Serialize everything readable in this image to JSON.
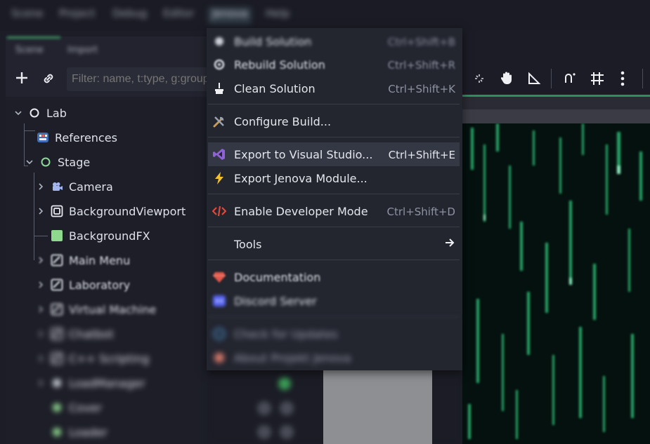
{
  "menubar": {
    "items": [
      {
        "label": "Scene"
      },
      {
        "label": "Project"
      },
      {
        "label": "Debug"
      },
      {
        "label": "Editor"
      },
      {
        "label": "Jenova"
      },
      {
        "label": "Help"
      }
    ]
  },
  "scene_dock": {
    "tabs": [
      "Scene",
      "Import"
    ],
    "filter_placeholder": "Filter: name, t:type, g:group",
    "tree": [
      {
        "label": "Lab",
        "icon": "node-circle-icon"
      },
      {
        "label": "References",
        "icon": "references-icon"
      },
      {
        "label": "Stage",
        "icon": "node-circle-green-icon"
      },
      {
        "label": "Camera",
        "icon": "camera-icon"
      },
      {
        "label": "BackgroundViewport",
        "icon": "viewport-icon"
      },
      {
        "label": "BackgroundFX",
        "icon": "color-rect-icon"
      },
      {
        "label": "Main Menu",
        "icon": "control-icon"
      },
      {
        "label": "Laboratory",
        "icon": "control-icon"
      },
      {
        "label": "Virtual Machine",
        "icon": "control-icon"
      },
      {
        "label": "Chatbot",
        "icon": "control-icon"
      },
      {
        "label": "C++ Scripting",
        "icon": "control-icon"
      },
      {
        "label": "LoadManager",
        "icon": "node-icon"
      },
      {
        "label": "Cover",
        "icon": "node-icon"
      },
      {
        "label": "Loader",
        "icon": "node-icon"
      }
    ]
  },
  "menu": {
    "items": [
      {
        "label": "Build Solution",
        "shortcut": "Ctrl+Shift+B",
        "icon": "hammer-icon"
      },
      {
        "label": "Rebuild Solution",
        "shortcut": "Ctrl+Shift+R",
        "icon": "rebuild-icon"
      },
      {
        "label": "Clean Solution",
        "shortcut": "Ctrl+Shift+K",
        "icon": "broom-icon"
      },
      {
        "label": "Configure Build...",
        "shortcut": "",
        "icon": "tools-icon"
      },
      {
        "label": "Export to Visual Studio...",
        "shortcut": "Ctrl+Shift+E",
        "icon": "visual-studio-icon"
      },
      {
        "label": "Export Jenova Module...",
        "shortcut": "",
        "icon": "lightning-icon"
      },
      {
        "label": "Enable Developer Mode",
        "shortcut": "Ctrl+Shift+D",
        "icon": "code-icon"
      },
      {
        "label": "Tools",
        "shortcut": "",
        "icon": "arrow-right-icon"
      },
      {
        "label": "Documentation",
        "shortcut": "",
        "icon": "gem-icon"
      },
      {
        "label": "Discord Server",
        "shortcut": "",
        "icon": "discord-icon"
      },
      {
        "label": "Check for Updates",
        "shortcut": "",
        "icon": "update-icon"
      },
      {
        "label": "About Projekt Jenova",
        "shortcut": "",
        "icon": "about-icon"
      }
    ]
  },
  "colors": {
    "accent_green": "#3f9b63",
    "highlight": "#343744",
    "menu_bg": "#23252f"
  }
}
